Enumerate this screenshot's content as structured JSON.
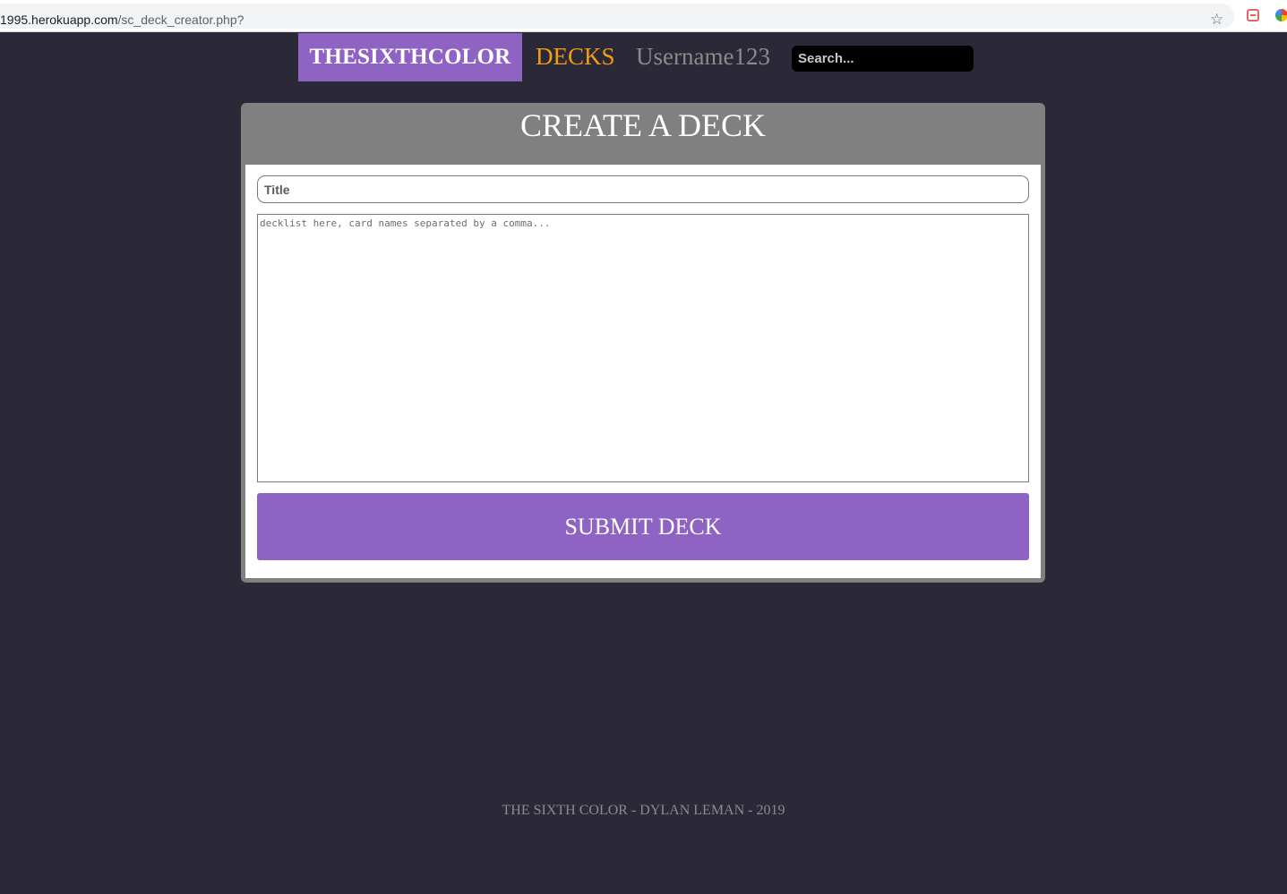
{
  "browser": {
    "url_host": "1995.herokuapp.com",
    "url_path": "/sc_deck_creator.php?",
    "icons": [
      "star-icon",
      "extension-icon",
      "color-wheel-icon"
    ]
  },
  "nav": {
    "brand": "THESIXTHCOLOR",
    "decks": "DECKS",
    "username": "Username123",
    "search_placeholder": "Search..."
  },
  "card": {
    "heading": "CREATE A DECK",
    "title_placeholder": "Title",
    "decklist_placeholder": "decklist here, card names separated by a comma...",
    "submit_label": "SUBMIT DECK"
  },
  "footer": {
    "text": "THE SIXTH COLOR - DYLAN LEMAN - 2019"
  },
  "colors": {
    "page_background": "#2b2837",
    "accent_purple": "#8e63c3",
    "decks_orange": "#f39c12",
    "muted_gray": "#8b8b8b",
    "card_header_gray": "#808080"
  }
}
